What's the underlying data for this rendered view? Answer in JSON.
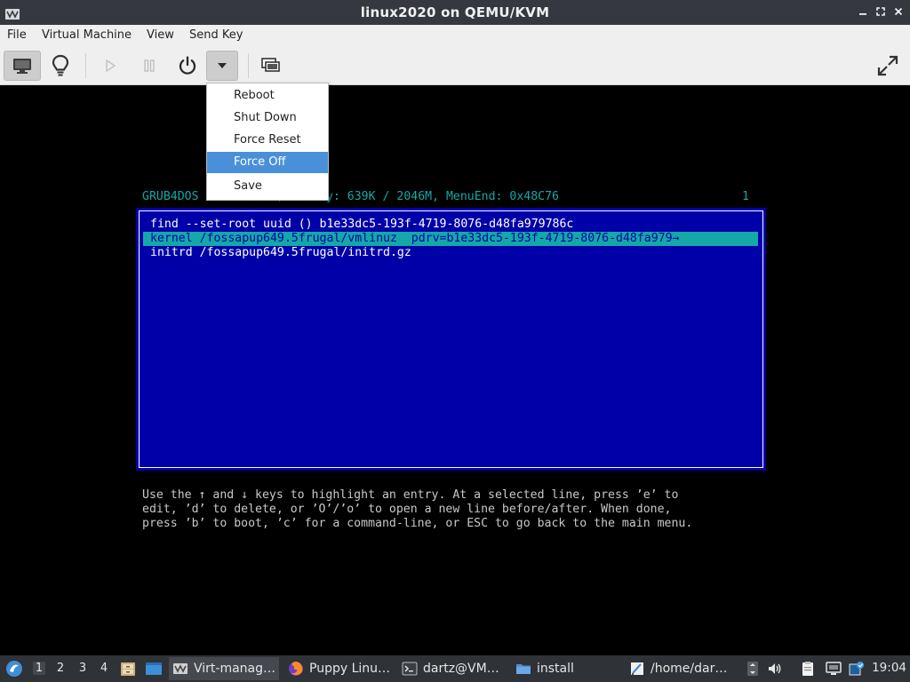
{
  "window": {
    "title": "linux2020 on QEMU/KVM"
  },
  "menubar": {
    "items": [
      "File",
      "Virtual Machine",
      "View",
      "Send Key"
    ]
  },
  "toolbar": {
    "buttons": [
      {
        "name": "console",
        "icon": "monitor-icon",
        "state": "pressed"
      },
      {
        "name": "details",
        "icon": "lightbulb-icon"
      },
      {
        "name": "run",
        "icon": "play-icon",
        "state": "disabled"
      },
      {
        "name": "pause",
        "icon": "pause-icon",
        "state": "disabled"
      },
      {
        "name": "shutdown",
        "icon": "power-icon"
      },
      {
        "name": "shutdown-menu",
        "icon": "chevron-down-icon",
        "state": "pressed"
      },
      {
        "name": "snapshots",
        "icon": "snapshots-icon"
      },
      {
        "name": "fullscreen",
        "icon": "fullscreen-icon"
      }
    ]
  },
  "shutdown_menu": {
    "items": [
      "Reboot",
      "Shut Down",
      "Force Reset",
      "Force Off",
      "Save"
    ],
    "selected": "Force Off"
  },
  "console": {
    "status_visible": "GRUB4DOS",
    "status_rest": "20, Memory: 639K / 2046M, MenuEnd: 0x48C76",
    "status_right": "1",
    "entry_lines": [
      "find --set-root uuid () b1e33dc5-193f-4719-8076-d48fa979786c",
      "kernel /fossapup649.5frugal/vmlinuz  pdrv=b1e33dc5-193f-4719-8076-d48fa979→",
      "initrd /fossapup649.5frugal/initrd.gz"
    ],
    "selected_line": 1,
    "help_lines": [
      "Use the ↑ and ↓ keys to highlight an entry. At a selected line, press ’e’ to",
      "edit, ’d’ to delete, or ’O’/’o’ to open a new line before/after. When done,",
      "press ’b’ to boot, ’c’ for a command-line, or ESC to go back to the main menu."
    ],
    "colors": {
      "grub_blue": "#0000a8",
      "grub_cyan": "#14a8a8"
    }
  },
  "taskbar": {
    "workspaces": [
      "1",
      "2",
      "3",
      "4"
    ],
    "active_workspace": "1",
    "tasks": [
      {
        "label": "Virt-manag…",
        "icon": "virt-manager-icon",
        "active": true
      },
      {
        "label": "Puppy Linu…",
        "icon": "firefox-icon"
      },
      {
        "label": "dartz@VM…",
        "icon": "terminal-icon"
      },
      {
        "label": "install",
        "icon": "folder-icon"
      },
      {
        "label": "/home/dar…",
        "icon": "text-editor-icon"
      }
    ],
    "tray_icons": [
      "scroll-indicator-icon",
      "volume-icon",
      "clipboard-icon",
      "network-icon",
      "updates-icon"
    ],
    "clock": "19:04"
  }
}
